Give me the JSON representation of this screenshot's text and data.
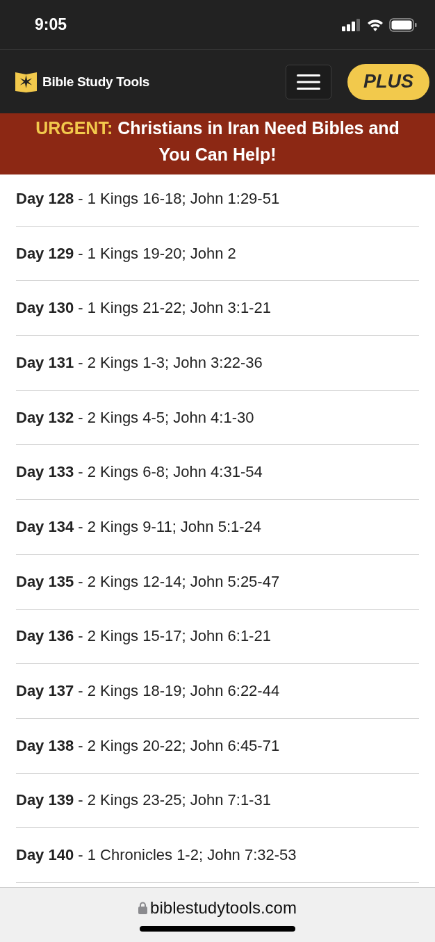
{
  "status_bar": {
    "time": "9:05"
  },
  "header": {
    "logo_text": "Bible Study Tools",
    "plus_button": "PLUS"
  },
  "banner": {
    "label": "URGENT:",
    "text": "Christians in Iran Need Bibles and You Can Help!"
  },
  "readings": [
    {
      "text": "**Day 128** - 1 Kings 16-18; John 1:29-51"
    },
    {
      "text": "**Day 129** - 1 Kings 19-20; John 2"
    },
    {
      "text": "**Day 130** - 1 Kings 21-22; John 3:1-21"
    },
    {
      "text": "**Day 131** - 2 Kings 1-3; John 3:22-36"
    },
    {
      "text": "**Day 132** - 2 Kings 4-5; John 4:1-30"
    },
    {
      "text": "**Day 133** - 2 Kings 6-8; John 4:31-54"
    },
    {
      "text": "**Day 134** - 2 Kings 9-11; John 5:1-24"
    },
    {
      "text": "**Day 135** - 2 Kings 12-14; John 5:25-47"
    },
    {
      "text": "**Day 136** - 2 Kings 15-17; John 6:1-21"
    },
    {
      "text": "**Day 137** - 2 Kings 18-19; John 6:22-44"
    },
    {
      "text": "**Day 138** - 2 Kings 20-22; John 6:45-71"
    },
    {
      "text": "**Day 139** - 2 Kings 23-25; John 7:1-31"
    },
    {
      "text": "**Day 140** - 1 Chronicles 1-2; John 7:32-53"
    }
  ],
  "address_bar": {
    "url": "biblestudytools.com"
  }
}
